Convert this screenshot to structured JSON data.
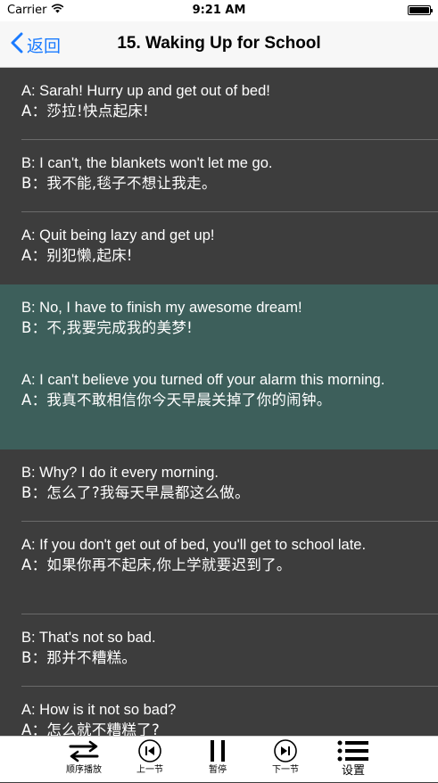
{
  "status_bar": {
    "carrier": "Carrier",
    "time": "9:21 AM"
  },
  "nav": {
    "back_label": "返回",
    "title": "15. Waking Up for School"
  },
  "dialogue": [
    {
      "en": "A: Sarah! Hurry up and get out of bed!",
      "cn": "A：莎拉!快点起床!",
      "highlighted": false
    },
    {
      "en": "B: I can't, the blankets won't let me go.",
      "cn": "B：我不能,毯子不想让我走。",
      "highlighted": false
    },
    {
      "en": "A: Quit being lazy and get up!",
      "cn": "A：别犯懒,起床!",
      "highlighted": false
    },
    {
      "en": "B: No, I have to finish my awesome dream!",
      "cn": "B：不,我要完成我的美梦!",
      "highlighted": true
    },
    {
      "en": "A: I can't believe you turned off your alarm this morning.",
      "cn": "A：我真不敢相信你今天早晨关掉了你的闹钟。",
      "highlighted": true
    },
    {
      "en": "B: Why? I do it every morning.",
      "cn": "B：怎么了?我每天早晨都这么做。",
      "highlighted": false
    },
    {
      "en": "A: If you don't get out of bed, you'll get to school late.",
      "cn": "A：如果你再不起床,你上学就要迟到了。",
      "highlighted": false
    },
    {
      "en": "B: That's not so bad.",
      "cn": "B：那并不糟糕。",
      "highlighted": false
    },
    {
      "en": "A: How is it not so bad?",
      "cn": "A：怎么就不糟糕了?",
      "highlighted": false
    }
  ],
  "tabbar": {
    "sequential": "顺序播放",
    "previous": "上一节",
    "pause": "暂停",
    "next": "下一节",
    "settings": "设置"
  },
  "colors": {
    "accent": "#1a7bff",
    "background": "#3d3d3d",
    "highlight": "#3d5f5b"
  }
}
